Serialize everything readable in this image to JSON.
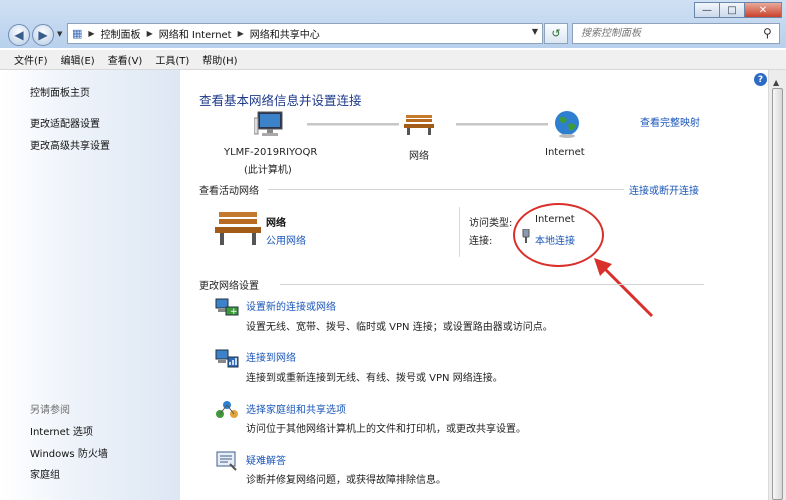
{
  "window": {
    "min_symbol": "—",
    "max_symbol": "□",
    "close_symbol": "✕"
  },
  "address": {
    "root_symbol": "▦",
    "crumbs": [
      "控制面板",
      "网络和 Internet",
      "网络和共享中心"
    ],
    "sep_symbol": "▶",
    "drop_symbol": "▼"
  },
  "search": {
    "placeholder": "搜索控制面板"
  },
  "menu": [
    "文件(F)",
    "编辑(E)",
    "查看(V)",
    "工具(T)",
    "帮助(H)"
  ],
  "sidebar": {
    "items": [
      "控制面板主页",
      "更改适配器设置",
      "更改高级共享设置"
    ],
    "see_also_title": "另请参阅",
    "see_also": [
      "Internet 选项",
      "Windows 防火墙",
      "家庭组"
    ]
  },
  "main": {
    "title": "查看基本网络信息并设置连接",
    "full_map_link": "查看完整映射",
    "map": {
      "computer_name": "YLMF-2019RIYOQR",
      "computer_sub": "(此计算机)",
      "network_label": "网络",
      "internet_label": "Internet"
    },
    "active_section": "查看活动网络",
    "connect_link": "连接或断开连接",
    "network": {
      "name": "网络",
      "type": "公用网络"
    },
    "access_type_label": "访问类型:",
    "access_type_value": "Internet",
    "connections_label": "连接:",
    "connections_value": "本地连接",
    "change_section": "更改网络设置",
    "options": [
      {
        "title": "设置新的连接或网络",
        "desc": "设置无线、宽带、拨号、临时或 VPN 连接；或设置路由器或访问点。"
      },
      {
        "title": "连接到网络",
        "desc": "连接到或重新连接到无线、有线、拨号或 VPN 网络连接。"
      },
      {
        "title": "选择家庭组和共享选项",
        "desc": "访问位于其他网络计算机上的文件和打印机，或更改共享设置。"
      },
      {
        "title": "疑难解答",
        "desc": "诊断并修复网络问题，或获得故障排除信息。"
      }
    ]
  },
  "colors": {
    "link": "#1a56b8",
    "title": "#1e3a8a",
    "annotation": "#d9302b"
  }
}
